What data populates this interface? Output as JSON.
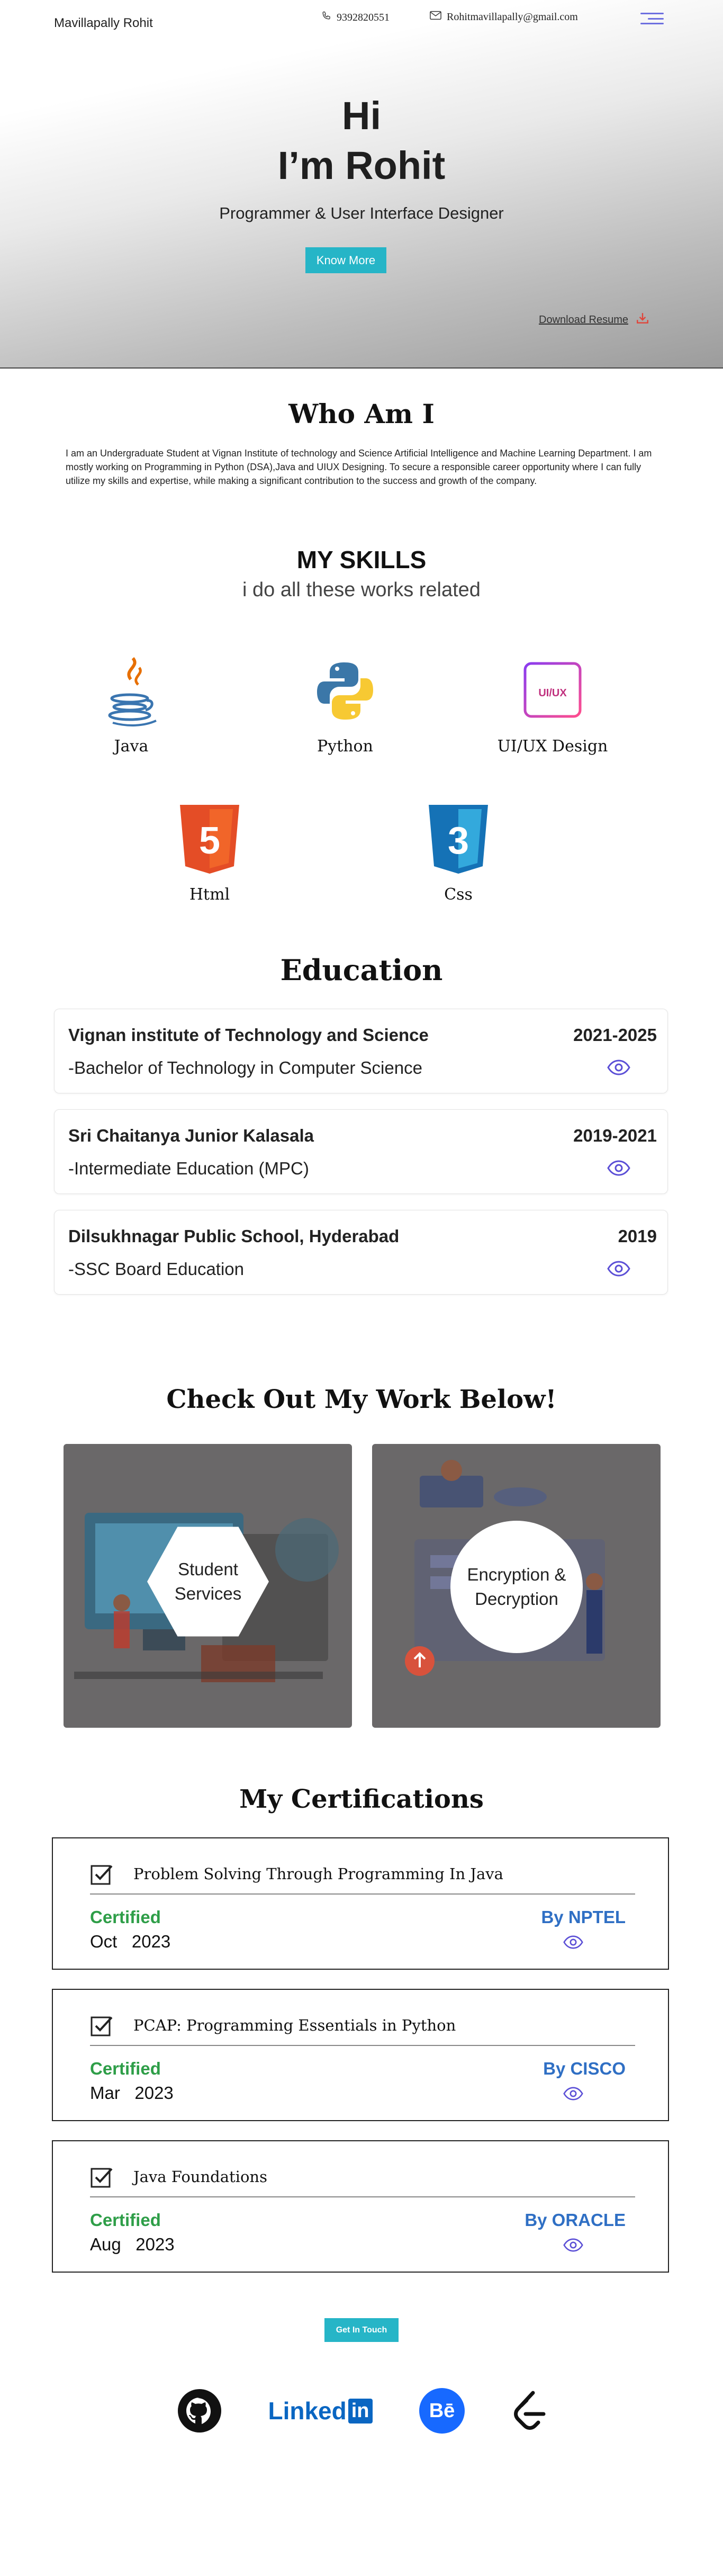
{
  "header": {
    "brand": "Mavillapally Rohit",
    "phone": "9392820551",
    "email": "Rohitmavillapally@gmail.com"
  },
  "hero": {
    "greeting": "Hi",
    "name": "I’m Rohit",
    "role": "Programmer & User Interface Designer",
    "cta_label": "Know More",
    "download_label": "Download Resume"
  },
  "about": {
    "title": "Who Am I",
    "text": "I am an Undergraduate Student at Vignan Institute of technology and Science Artificial Intelligence and Machine Learning Department. I am mostly working on Programming in Python (DSA),Java and UIUX Designing. To secure a responsible career opportunity where I can fully utilize my skills and expertise, while making a significant contribution to the success and growth of the company."
  },
  "skills": {
    "title": "MY SKILLS",
    "subtitle": "i do all these works related",
    "items": [
      {
        "label": "Java",
        "icon": "java-icon"
      },
      {
        "label": "Python",
        "icon": "python-icon"
      },
      {
        "label": "UI/UX Design",
        "icon": "uiux-icon",
        "badge": "UI/UX"
      },
      {
        "label": "Html",
        "icon": "html5-icon",
        "badge": "5"
      },
      {
        "label": "Css",
        "icon": "css3-icon",
        "badge": "3"
      }
    ]
  },
  "education": {
    "title": "Education",
    "items": [
      {
        "school": "Vignan institute of Technology and Science",
        "years": "2021-2025",
        "degree": "-Bachelor of Technology in Computer Science"
      },
      {
        "school": "Sri Chaitanya Junior Kalasala",
        "years": "2019-2021",
        "degree": "-Intermediate Education (MPC)"
      },
      {
        "school": "Dilsukhnagar Public School, Hyderabad",
        "years": "2019",
        "degree": "-SSC Board Education"
      }
    ]
  },
  "work": {
    "title": "Check Out My Work Below!",
    "items": [
      {
        "line1": "Student",
        "line2": "Services"
      },
      {
        "line1": "Encryption &",
        "line2": "Decryption"
      }
    ]
  },
  "certifications": {
    "title": "My Certifications",
    "items": [
      {
        "title": "Problem Solving Through Programming In Java",
        "status": "Certified",
        "month": "Oct",
        "year": "2023",
        "issuer": "By NPTEL"
      },
      {
        "title": "PCAP: Programming Essentials in Python",
        "status": "Certified",
        "month": "Mar",
        "year": "2023",
        "issuer": "By CISCO"
      },
      {
        "title": "Java Foundations",
        "status": "Certified",
        "month": "Aug",
        "year": "2023",
        "issuer": "By ORACLE"
      }
    ]
  },
  "footer": {
    "cta_label": "Get In Touch",
    "social": [
      {
        "name": "github-icon"
      },
      {
        "name": "linkedin-icon",
        "text_a": "Linked",
        "text_b": "in"
      },
      {
        "name": "behance-icon",
        "text": "Bē"
      },
      {
        "name": "leetcode-icon"
      }
    ]
  },
  "colors": {
    "accent": "#26b5c7",
    "menu": "#6d6fe0",
    "certified": "#2e9e48",
    "issuer": "#2f6fc4",
    "eye": "#5b4fd6",
    "work_bg": "#6a6869"
  }
}
